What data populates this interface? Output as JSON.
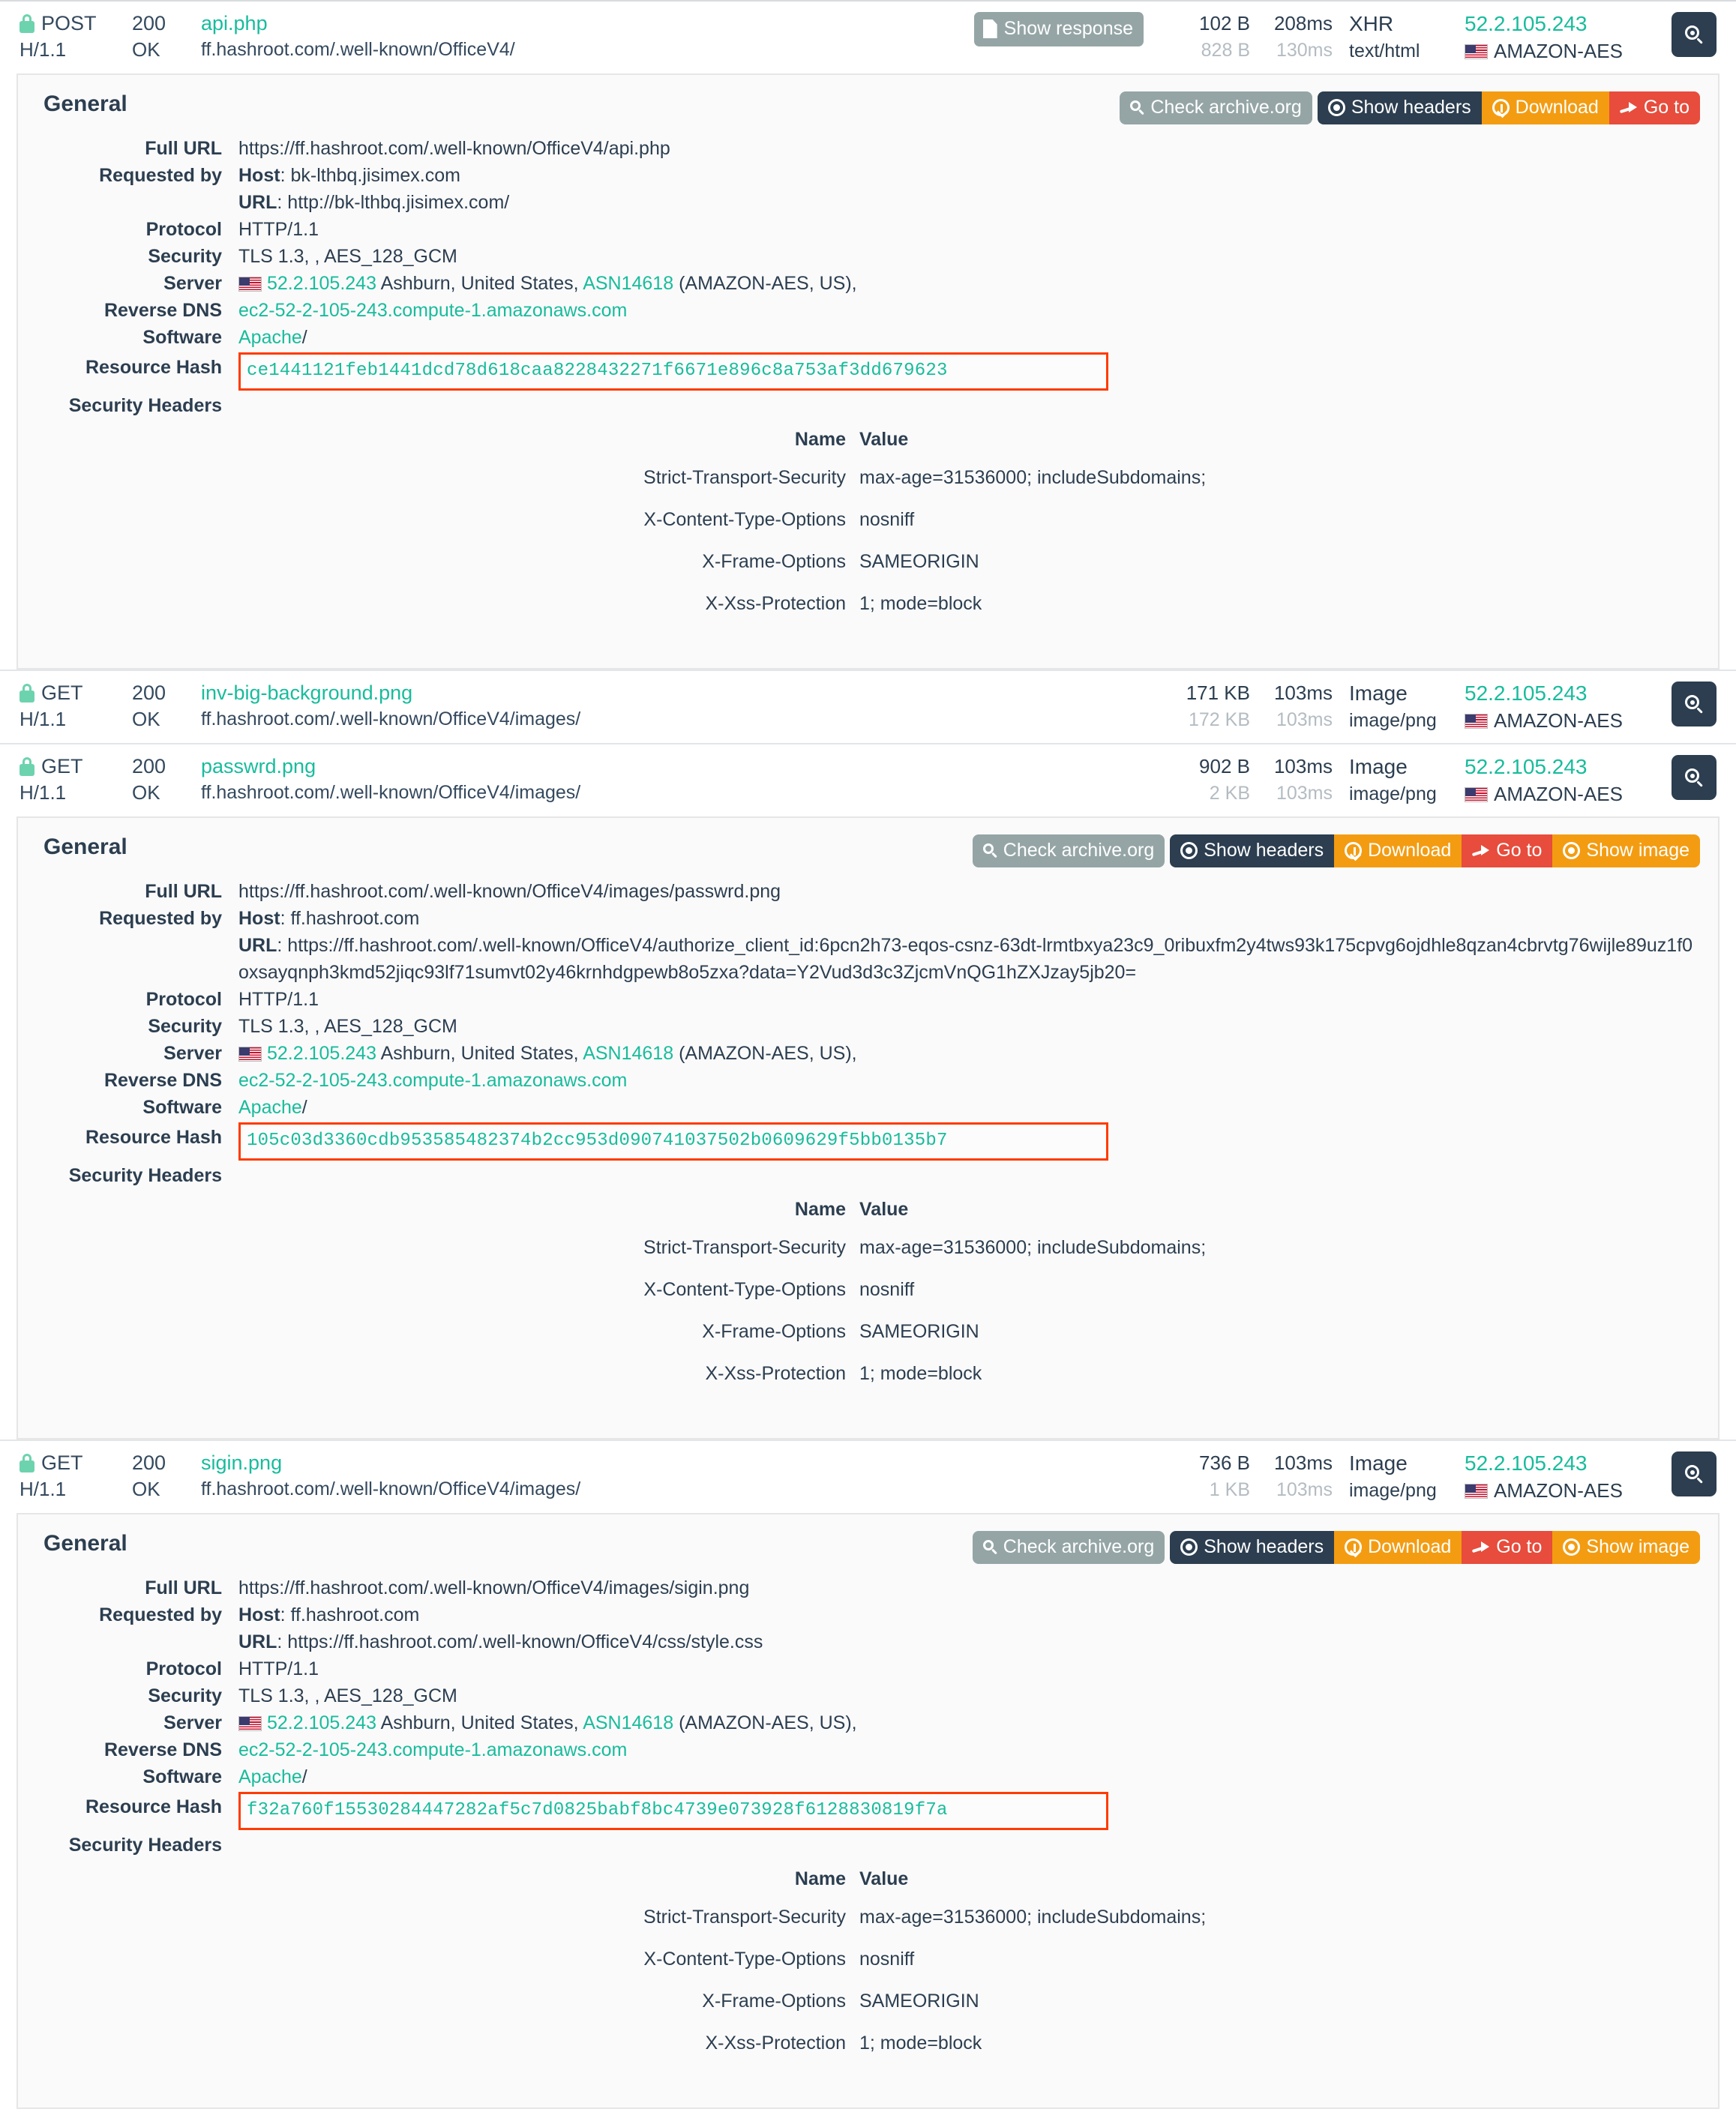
{
  "colors": {
    "accent_green": "#18bc9c",
    "dark_navy": "#2c3e50",
    "orange": "#f39c12",
    "red": "#e74c3c",
    "grey": "#95a5a6",
    "highlight_border": "#ff3b00"
  },
  "buttons": {
    "show_response": "Show response",
    "check_archive": "Check archive.org",
    "show_headers": "Show headers",
    "download": "Download",
    "goto": "Go to",
    "show_image": "Show image"
  },
  "labels": {
    "general": "General",
    "full_url": "Full URL",
    "requested_by": "Requested by",
    "protocol": "Protocol",
    "security": "Security",
    "server": "Server",
    "reverse_dns": "Reverse DNS",
    "software": "Software",
    "resource_hash": "Resource Hash",
    "security_headers": "Security Headers",
    "host_prefix": "Host",
    "url_prefix": "URL",
    "col_name": "Name",
    "col_value": "Value"
  },
  "requests": [
    {
      "method": "POST",
      "http_version": "H/1.1",
      "status_code": "200",
      "status_text": "OK",
      "filename": "api.php",
      "path": "ff.hashroot.com/.well-known/OfficeV4/",
      "size_primary": "102 B",
      "size_secondary": "828 B",
      "time_primary": "208ms",
      "time_secondary": "130ms",
      "type_primary": "XHR",
      "type_secondary": "text/html",
      "ip": "52.2.105.243",
      "org": "AMAZON-AES",
      "has_show_response": true
    },
    {
      "method": "GET",
      "http_version": "H/1.1",
      "status_code": "200",
      "status_text": "OK",
      "filename": "inv-big-background.png",
      "path": "ff.hashroot.com/.well-known/OfficeV4/images/",
      "size_primary": "171 KB",
      "size_secondary": "172 KB",
      "time_primary": "103ms",
      "time_secondary": "103ms",
      "type_primary": "Image",
      "type_secondary": "image/png",
      "ip": "52.2.105.243",
      "org": "AMAZON-AES",
      "has_show_response": false
    },
    {
      "method": "GET",
      "http_version": "H/1.1",
      "status_code": "200",
      "status_text": "OK",
      "filename": "passwrd.png",
      "path": "ff.hashroot.com/.well-known/OfficeV4/images/",
      "size_primary": "902 B",
      "size_secondary": "2 KB",
      "time_primary": "103ms",
      "time_secondary": "103ms",
      "type_primary": "Image",
      "type_secondary": "image/png",
      "ip": "52.2.105.243",
      "org": "AMAZON-AES",
      "has_show_response": false
    },
    {
      "method": "GET",
      "http_version": "H/1.1",
      "status_code": "200",
      "status_text": "OK",
      "filename": "sigin.png",
      "path": "ff.hashroot.com/.well-known/OfficeV4/images/",
      "size_primary": "736 B",
      "size_secondary": "1 KB",
      "time_primary": "103ms",
      "time_secondary": "103ms",
      "type_primary": "Image",
      "type_secondary": "image/png",
      "ip": "52.2.105.243",
      "org": "AMAZON-AES",
      "has_show_response": false
    }
  ],
  "panels": [
    {
      "full_url": "https://ff.hashroot.com/.well-known/OfficeV4/api.php",
      "requested_host": "bk-lthbq.jisimex.com",
      "requested_url": "http://bk-lthbq.jisimex.com/",
      "protocol": "HTTP/1.1",
      "security": "TLS 1.3, , AES_128_GCM",
      "server_ip": "52.2.105.243",
      "server_loc": "Ashburn, United States,",
      "server_asn": "ASN14618",
      "server_asn_tail": "(AMAZON-AES, US),",
      "reverse_dns": "ec2-52-2-105-243.compute-1.amazonaws.com",
      "software": "Apache",
      "software_tail": "/",
      "resource_hash": "ce1441121feb1441dcd78d618caa8228432271f6671e896c8a753af3dd679623",
      "has_show_image": false,
      "headers": [
        {
          "name": "Strict-Transport-Security",
          "value": "max-age=31536000; includeSubdomains;"
        },
        {
          "name": "X-Content-Type-Options",
          "value": "nosniff"
        },
        {
          "name": "X-Frame-Options",
          "value": "SAMEORIGIN"
        },
        {
          "name": "X-Xss-Protection",
          "value": "1; mode=block"
        }
      ]
    },
    {
      "full_url": "https://ff.hashroot.com/.well-known/OfficeV4/images/passwrd.png",
      "requested_host": "ff.hashroot.com",
      "requested_url": "https://ff.hashroot.com/.well-known/OfficeV4/authorize_client_id:6pcn2h73-eqos-csnz-63dt-lrmtbxya23c9_0ribuxfm2y4tws93k175cpvg6ojdhle8qzan4cbrvtg76wijle89uz1f0oxsayqnph3kmd52jiqc93lf71sumvt02y46krnhdgpewb8o5zxa?data=Y2Vud3d3c3ZjcmVnQG1hZXJzay5jb20=",
      "protocol": "HTTP/1.1",
      "security": "TLS 1.3, , AES_128_GCM",
      "server_ip": "52.2.105.243",
      "server_loc": "Ashburn, United States,",
      "server_asn": "ASN14618",
      "server_asn_tail": "(AMAZON-AES, US),",
      "reverse_dns": "ec2-52-2-105-243.compute-1.amazonaws.com",
      "software": "Apache",
      "software_tail": "/",
      "resource_hash": "105c03d3360cdb953585482374b2cc953d090741037502b0609629f5bb0135b7",
      "has_show_image": true,
      "headers": [
        {
          "name": "Strict-Transport-Security",
          "value": "max-age=31536000; includeSubdomains;"
        },
        {
          "name": "X-Content-Type-Options",
          "value": "nosniff"
        },
        {
          "name": "X-Frame-Options",
          "value": "SAMEORIGIN"
        },
        {
          "name": "X-Xss-Protection",
          "value": "1; mode=block"
        }
      ]
    },
    {
      "full_url": "https://ff.hashroot.com/.well-known/OfficeV4/images/sigin.png",
      "requested_host": "ff.hashroot.com",
      "requested_url": "https://ff.hashroot.com/.well-known/OfficeV4/css/style.css",
      "protocol": "HTTP/1.1",
      "security": "TLS 1.3, , AES_128_GCM",
      "server_ip": "52.2.105.243",
      "server_loc": "Ashburn, United States,",
      "server_asn": "ASN14618",
      "server_asn_tail": "(AMAZON-AES, US),",
      "reverse_dns": "ec2-52-2-105-243.compute-1.amazonaws.com",
      "software": "Apache",
      "software_tail": "/",
      "resource_hash": "f32a760f15530284447282af5c7d0825babf8bc4739e073928f6128830819f7a",
      "has_show_image": true,
      "headers": [
        {
          "name": "Strict-Transport-Security",
          "value": "max-age=31536000; includeSubdomains;"
        },
        {
          "name": "X-Content-Type-Options",
          "value": "nosniff"
        },
        {
          "name": "X-Frame-Options",
          "value": "SAMEORIGIN"
        },
        {
          "name": "X-Xss-Protection",
          "value": "1; mode=block"
        }
      ]
    }
  ]
}
